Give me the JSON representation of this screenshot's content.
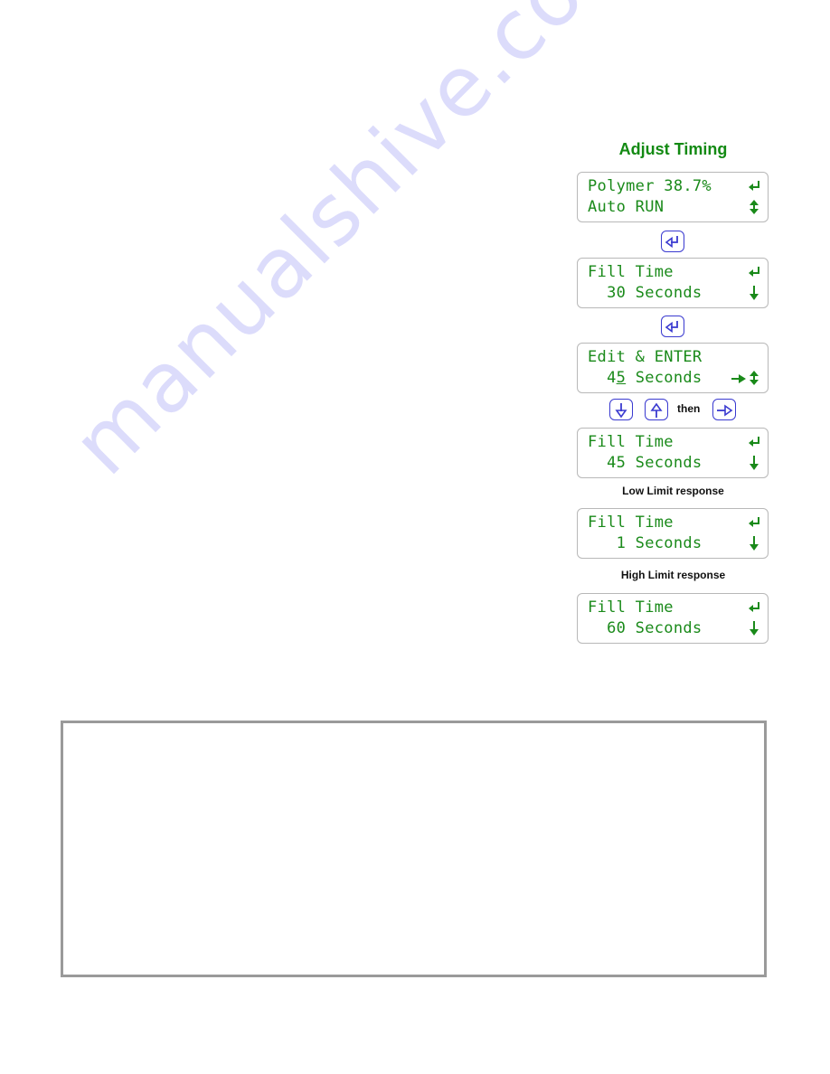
{
  "watermark": "manualshive.com",
  "title": "Adjust Timing",
  "colors": {
    "lcd_text": "#1a8a1a",
    "title": "#138a13",
    "key_border": "#3a3ad0",
    "box_border": "#9a9a9a"
  },
  "screens": [
    {
      "line1": "Polymer 38.7%",
      "line2": "Auto RUN",
      "icons": [
        "enter-icon",
        "up-down-icon"
      ]
    },
    {
      "line1": "Fill Time",
      "line2": "  30 Seconds",
      "icons": [
        "enter-icon",
        "down-arrow-icon"
      ]
    },
    {
      "line1": "Edit & ENTER",
      "line2_pre": "  4",
      "line2_cursor": "5",
      "line2_post": " Seconds",
      "icons": [
        "right-arrow-icon",
        "up-down-icon"
      ]
    },
    {
      "line1": "Fill Time",
      "line2": "  45 Seconds",
      "icons": [
        "enter-icon",
        "down-arrow-icon"
      ]
    },
    {
      "line1": "Fill Time",
      "line2": "   1 Seconds",
      "icons": [
        "enter-icon",
        "down-arrow-icon"
      ]
    },
    {
      "line1": "Fill Time",
      "line2": "  60 Seconds",
      "icons": [
        "enter-icon",
        "down-arrow-icon"
      ]
    }
  ],
  "keys": {
    "enter": "enter-key",
    "down": "down-key",
    "up": "up-key",
    "right": "right-key"
  },
  "then_label": "then",
  "captions": {
    "low_limit": "Low Limit response",
    "high_limit": "High Limit response"
  }
}
